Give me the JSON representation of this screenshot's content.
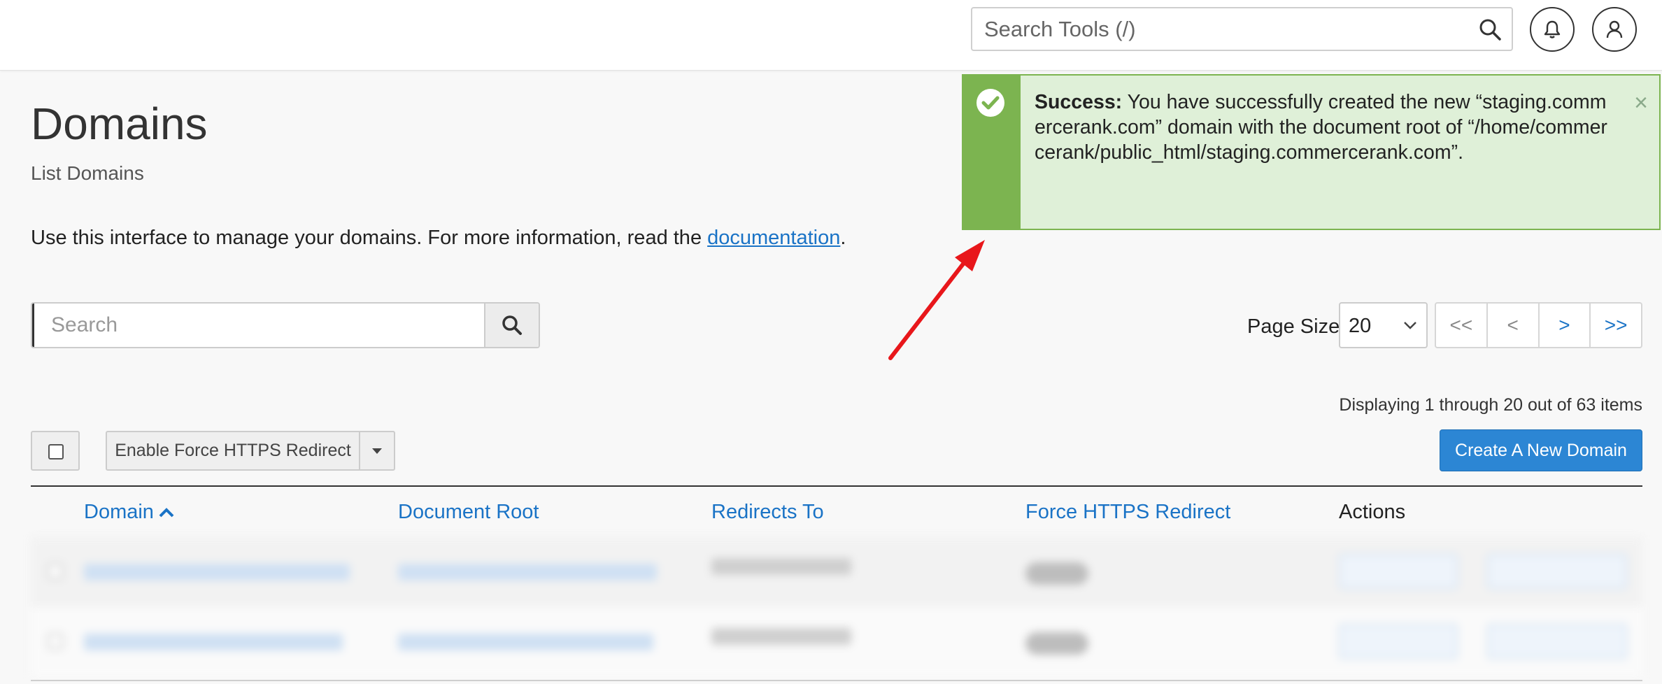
{
  "topbar": {
    "search_placeholder": "Search Tools (/)"
  },
  "page": {
    "title": "Domains",
    "subtitle": "List Domains",
    "intro_text": "Use this interface to manage your domains. For more information, read the ",
    "intro_link": "documentation",
    "intro_end": "."
  },
  "alert": {
    "label": "Success:",
    "message": " You have successfully created the new “staging.commercerank.com” domain with the document root of “/home/commercerank/public_html/staging.commercerank.com”.",
    "close": "×",
    "color": "#7cb450"
  },
  "search": {
    "placeholder": "Search"
  },
  "pagination": {
    "page_size_label": "Page Size",
    "page_size_value": "20",
    "buttons": [
      "<<",
      "<",
      ">",
      ">>"
    ],
    "display_count": "Displaying 1 through 20 out of 63 items"
  },
  "toolbar": {
    "https_label": "Enable Force HTTPS Redirect",
    "create_label": "Create A New Domain",
    "accent": "#2c86d4"
  },
  "table": {
    "headers": [
      "Domain",
      "Document Root",
      "Redirects To",
      "Force HTTPS Redirect",
      "Actions"
    ]
  }
}
